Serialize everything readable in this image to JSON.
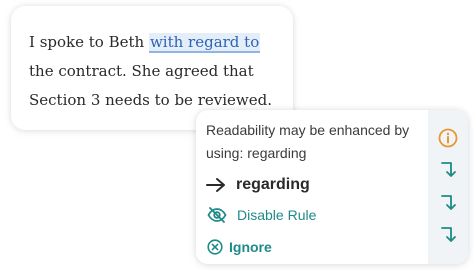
{
  "editor": {
    "text_before": "I spoke to Beth ",
    "highlighted_phrase": "with regard to",
    "text_line2": "the contract. She agreed that",
    "text_line3": "Section 3 needs to be reviewed."
  },
  "suggestion": {
    "message": "Readability may be enhanced by using: regarding",
    "replacement": "regarding",
    "replacement_icon": "arrow-right-icon",
    "disable_rule_label": "Disable Rule",
    "disable_rule_icon": "eye-off-icon",
    "ignore_label": "Ignore",
    "ignore_icon": "close-circle-icon"
  },
  "rail": {
    "icons": [
      "info-icon",
      "arrow-turn-down-icon",
      "arrow-turn-down-icon",
      "arrow-turn-down-icon"
    ]
  },
  "colors": {
    "accent_teal": "#1f8a88",
    "info_orange": "#e8962e",
    "highlight_bg": "#e3eef8",
    "highlight_text": "#2f63b5"
  }
}
